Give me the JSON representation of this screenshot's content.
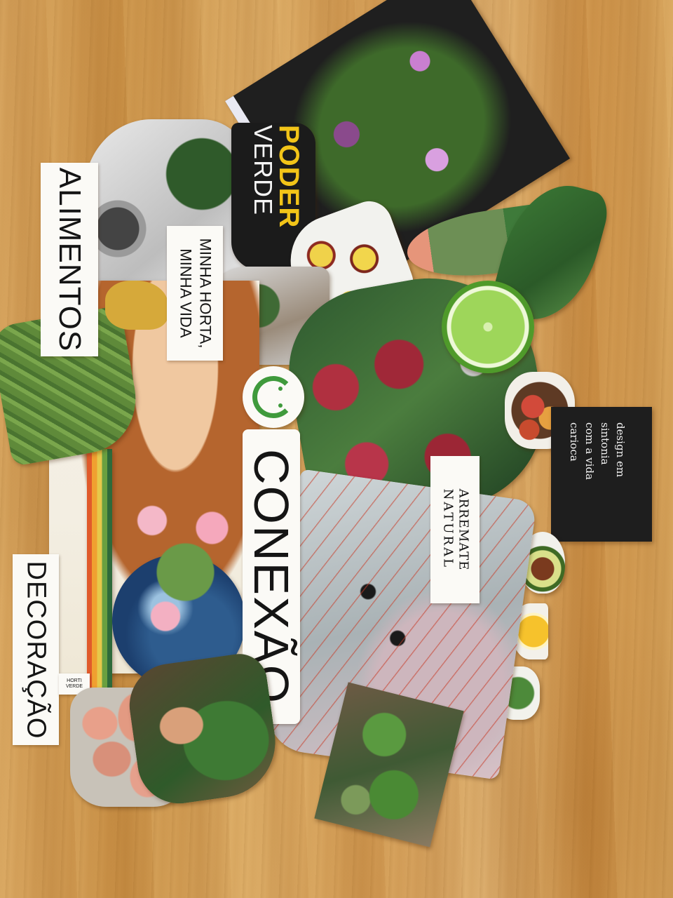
{
  "collage": {
    "words": {
      "alimentos": "ALIMENTOS",
      "minha_horta_line1": "MINHA HORTA,",
      "minha_horta_line2": "MINHA VIDA",
      "poder": "PODER",
      "verde": "VERDE",
      "conexao": "CONEXÃO",
      "decoracao": "DECORAÇÃO",
      "arremate_line1": "ARREMATE",
      "arremate_line2": "NATURAL",
      "design_line1": "design em",
      "design_line2": "sintonia",
      "design_line3": "com a vida",
      "design_line4": "carioca",
      "small_stamp": "HORTI VERDE"
    },
    "colors": {
      "wood": "#d3a05a",
      "poder_yellow": "#f2c418",
      "logo_green": "#3f9a3c",
      "paper": "#fbfaf6",
      "dark_card": "#1e1e1e"
    }
  }
}
